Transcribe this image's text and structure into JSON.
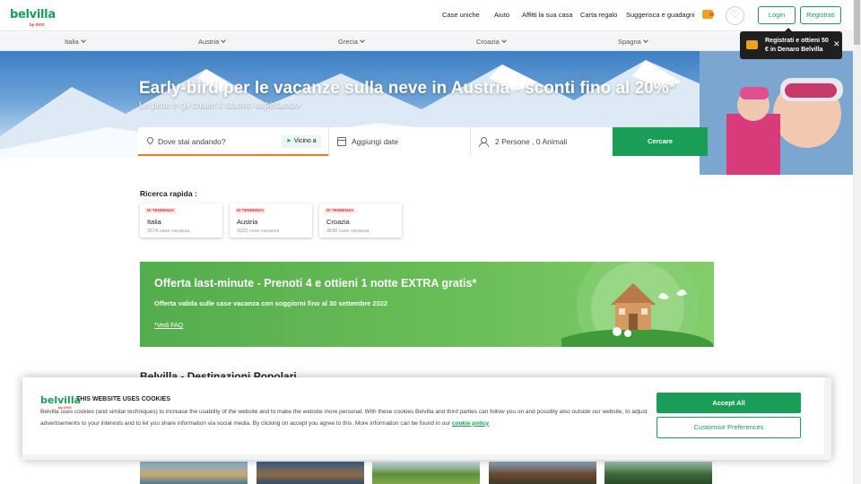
{
  "brand": {
    "name": "belvilla",
    "by_prefix": "by ",
    "by_brand": "OYO",
    "brand_color": "#1a9e57"
  },
  "topnav": {
    "items": [
      "Case uniche",
      "Aiuto",
      "Affitti la sua casa",
      "Carta regalo",
      "Suggerisca e guadagni"
    ],
    "login": "Login",
    "register": "Registrati",
    "heart": "♡"
  },
  "countries": [
    "Italia",
    "Austria",
    "Grecia",
    "Croazia",
    "Spagna"
  ],
  "promo": {
    "text": "Registrati e ottieni 50 € in Denaro Belvilla",
    "close": "✕"
  },
  "hero": {
    "title": "Early-bird per le vacanze sulla neve in Austria - sconti fino al 20%*",
    "subtitle": "Le piste e gli chalet ti stanno aspettando!"
  },
  "search": {
    "where_placeholder": "Dove stai andando?",
    "near_arrow": "➤",
    "near_label": "Vicino a",
    "date_placeholder": "Aggiungi date",
    "guests": "2 Persone , 0 Animali",
    "button": "Cercare"
  },
  "quick_search": {
    "title": "Ricerca rapida :",
    "cards": [
      {
        "tag": "DI TENDENZA",
        "name": "Italia",
        "count": "3574 case vacanza"
      },
      {
        "tag": "DI TENDENZA",
        "name": "Austria",
        "count": "2022 case vacanza"
      },
      {
        "tag": "DI TENDENZA",
        "name": "Croazia",
        "count": "4530 case vacanza"
      }
    ]
  },
  "offer": {
    "title": "Offerta last-minute - Prenoti 4 e ottieni 1 notte EXTRA gratis*",
    "subtitle": "Offerta valida sulle case vacanza con soggiorni fino al 30 settembre 2022",
    "link": "*Vedi FAQ"
  },
  "destinations_title": "Belvilla - Destinazioni Popolari",
  "cookie": {
    "title": "THIS WEBSITE USES COOKIES",
    "text": "Belvilla uses cookies (and similar techniques) to increase the usability of the website and to make the website more personal. With these cookies Belvilla and third parties can follow you on and possibly also outside our website, to adjust advertisements to your interests and to let you share information via social media. By clicking on accept you agree to this. More information can be found in our ",
    "policy_link": "cookie policy",
    "period": ".",
    "accept": "Accept All",
    "customise": "Customise Preferences"
  }
}
